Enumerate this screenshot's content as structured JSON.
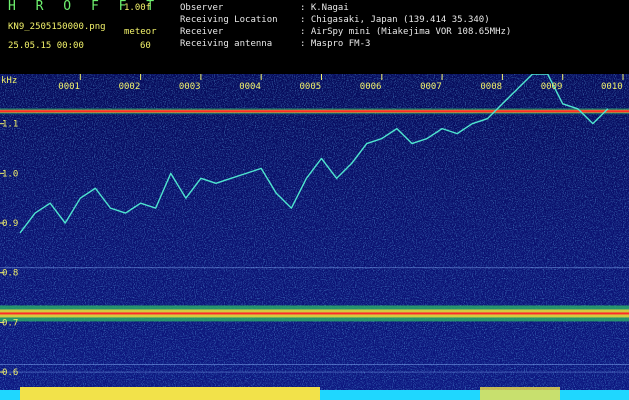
{
  "header": {
    "brand": "H R O F F T",
    "version": "1.00f",
    "filename": "KN9_2505150000.png",
    "meteor_label": "meteor",
    "date_time": "25.05.15 00:00",
    "number": "60",
    "rows": [
      {
        "label": "Observer",
        "value": ": K.Nagai"
      },
      {
        "label": "Receiving Location",
        "value": ": Chigasaki, Japan (139.414 35.340)"
      },
      {
        "label": "Receiver",
        "value": ": AirSpy mini (Miakejima VOR 108.65MHz)"
      },
      {
        "label": "Receiving antenna",
        "value": ": Maspro FM-3"
      }
    ]
  },
  "chart_data": {
    "type": "heatmap",
    "ylabel": "kHz",
    "ylim": [
      0.58,
      1.2
    ],
    "yticks": [
      "0.6",
      "0.7",
      "0.8",
      "0.9",
      "1.0",
      "1.1"
    ],
    "time_markers": [
      "0001",
      "0002",
      "0003",
      "0004",
      "0005",
      "0006",
      "0007",
      "0008",
      "0009",
      "0010"
    ],
    "carrier_lines_khz": [
      1.125,
      0.718
    ],
    "drift_trace": {
      "x": [
        0,
        0.25,
        0.5,
        0.75,
        1.0,
        1.25,
        1.5,
        1.75,
        2.0,
        2.25,
        2.5,
        2.75,
        3.0,
        3.25,
        3.5,
        3.75,
        4.0,
        4.25,
        4.5,
        4.75,
        5.0,
        5.25,
        5.5,
        5.75,
        6.0,
        6.25,
        6.5,
        6.75,
        7.0,
        7.25,
        7.5,
        7.75,
        8.0,
        8.25,
        8.5,
        8.75,
        9.0,
        9.25,
        9.5,
        9.75
      ],
      "y": [
        0.88,
        0.92,
        0.94,
        0.9,
        0.95,
        0.97,
        0.93,
        0.92,
        0.94,
        0.93,
        1.0,
        0.95,
        0.99,
        0.98,
        0.99,
        1.0,
        1.01,
        0.96,
        0.93,
        0.99,
        1.03,
        0.99,
        1.02,
        1.06,
        1.07,
        1.09,
        1.06,
        1.07,
        1.09,
        1.08,
        1.1,
        1.11,
        1.14,
        1.17,
        1.2,
        1.2,
        1.14,
        1.13,
        1.1,
        1.13
      ]
    }
  }
}
